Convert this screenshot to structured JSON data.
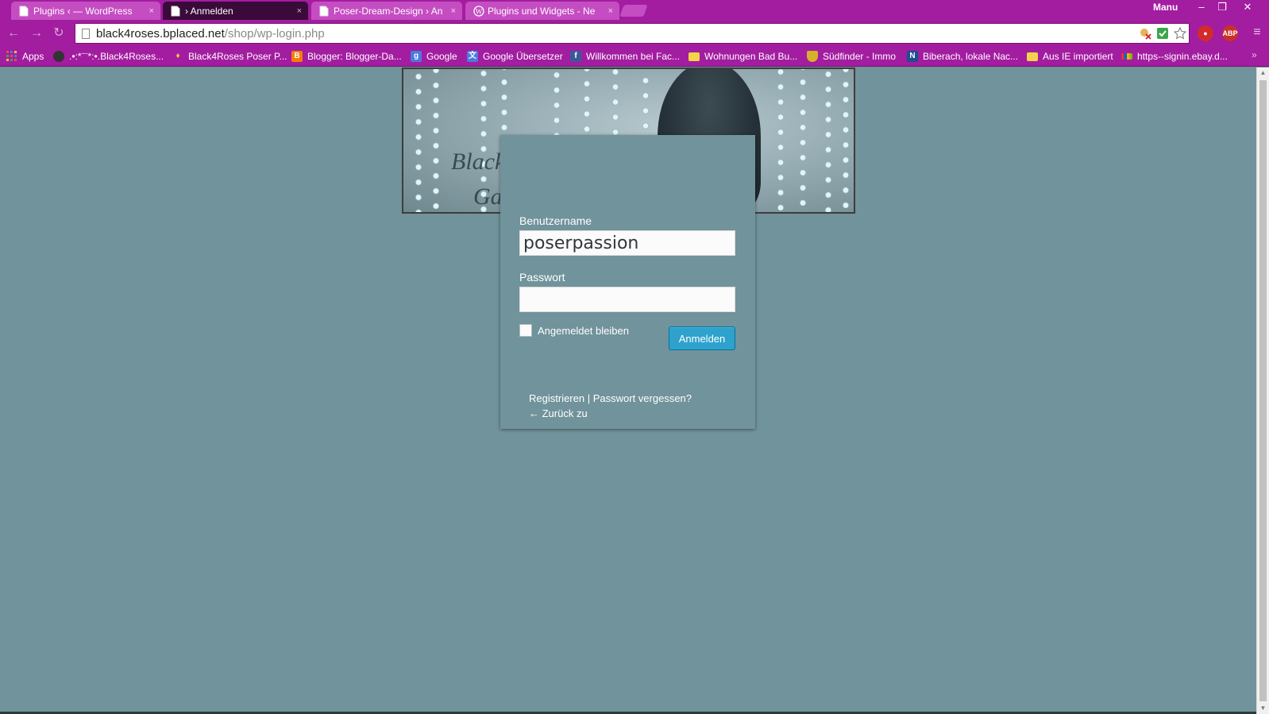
{
  "browser": {
    "tabs": [
      {
        "title": "Plugins ‹ — WordPress",
        "active": false,
        "icon": "page-icon"
      },
      {
        "title": "› Anmelden",
        "active": true,
        "icon": "page-icon"
      },
      {
        "title": "Poser-Dream-Design › An",
        "active": false,
        "icon": "page-icon"
      },
      {
        "title": "Plugins und Widgets - Ne",
        "active": false,
        "icon": "wordpress-icon"
      }
    ],
    "tab_close": "×",
    "profile_name": "Manu",
    "window_controls": {
      "minimize": "–",
      "restore": "❐",
      "close": "✕"
    },
    "nav": {
      "back": "←",
      "forward": "→",
      "reload": "↻"
    },
    "address": {
      "host": "black4roses.bplaced.net",
      "path": "/shop/wp-login.php"
    },
    "menu_icon": "≡",
    "bookmarks": [
      {
        "label": "Apps",
        "icon": "apps-grid-icon",
        "color": "#e34b4b"
      },
      {
        "label": ".•:*¨¨*:•.Black4Roses...",
        "icon": "globe-icon",
        "color": "#333333"
      },
      {
        "label": "Black4Roses Poser P...",
        "icon": "pin-icon",
        "color": "#e0a030"
      },
      {
        "label": "Blogger: Blogger-Da...",
        "icon": "blogger-icon",
        "color": "#f57d00"
      },
      {
        "label": "Google",
        "icon": "google-icon",
        "color": "#4a7be0"
      },
      {
        "label": "Google Übersetzer",
        "icon": "translate-icon",
        "color": "#4a7be0"
      },
      {
        "label": "Willkommen bei Fac...",
        "icon": "facebook-icon",
        "color": "#3b5998"
      },
      {
        "label": "Wohnungen Bad Bu...",
        "icon": "folder-icon",
        "color": "#f3d34a"
      },
      {
        "label": "Südfinder - Immo",
        "icon": "shield-icon",
        "color": "#d6b12a"
      },
      {
        "label": "Biberach, lokale Nac...",
        "icon": "news-icon",
        "color": "#1d4e8f"
      },
      {
        "label": "Aus IE importiert",
        "icon": "folder-icon",
        "color": "#f3d34a"
      },
      {
        "label": "https--signin.ebay.d...",
        "icon": "ebay-icon",
        "color": "#e53238"
      }
    ],
    "bookmarks_more": "»"
  },
  "banner": {
    "script_line1": "Black",
    "script_line2": "Ga"
  },
  "login": {
    "username_label": "Benutzername",
    "username_value": "poserpassion",
    "password_label": "Passwort",
    "password_value": "",
    "remember_label": "Angemeldet bleiben",
    "remember_checked": false,
    "submit_label": "Anmelden",
    "register_link": "Registrieren",
    "separator": "|",
    "lost_password_link": "Passwort vergessen?",
    "back_link": "← Zurück zu"
  },
  "colors": {
    "chrome_theme": "#a21da0",
    "page_background": "#71939b",
    "primary_button": "#2ea2cc"
  }
}
